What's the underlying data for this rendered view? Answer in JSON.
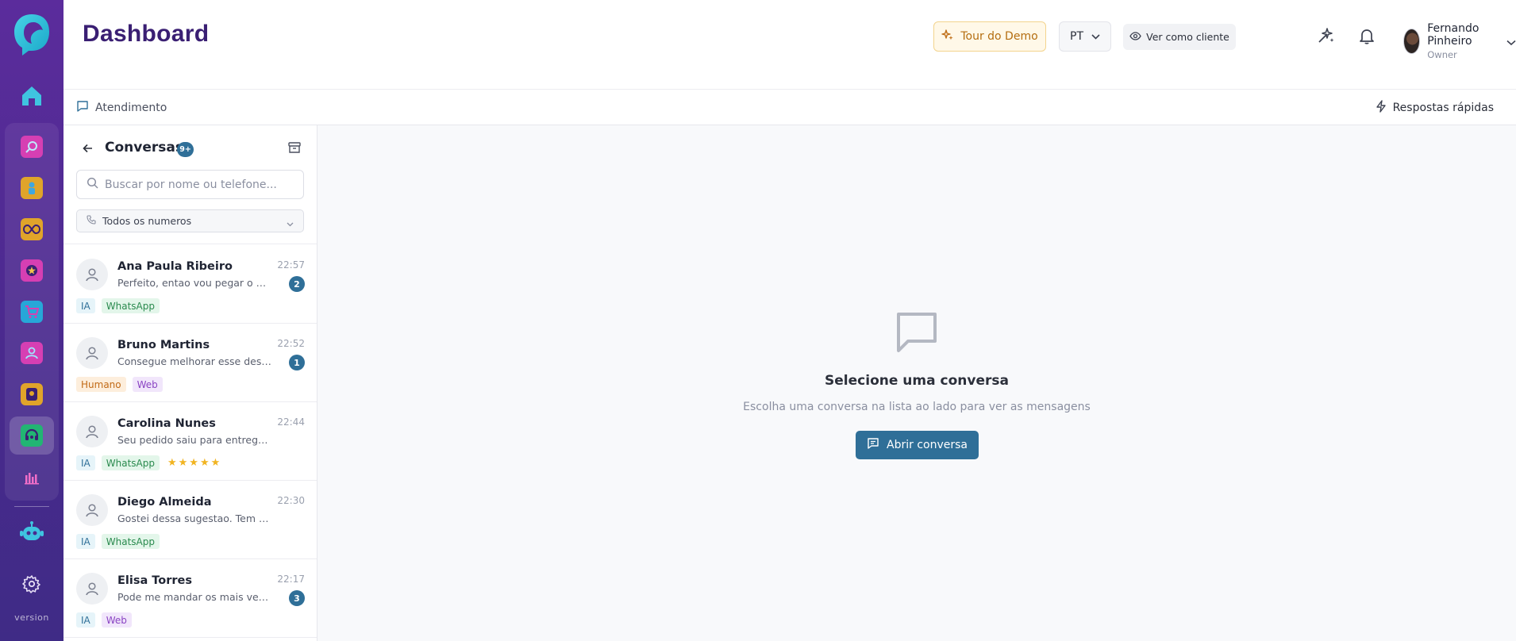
{
  "header": {
    "title": "Dashboard",
    "tour_label": "Tour do Demo",
    "language": "PT",
    "view_as_client_label": "Ver como cliente",
    "user": {
      "name": "Fernando Pinheiro",
      "role": "Owner"
    }
  },
  "sidebar": {
    "version_label": "version",
    "apps": [
      {
        "icon": "search-app-icon",
        "color": "#d63fb3"
      },
      {
        "icon": "person-app-icon",
        "color": "#e0a42a"
      },
      {
        "icon": "infinity-app-icon",
        "color": "#e0a42a"
      },
      {
        "icon": "star-badge-app-icon",
        "color": "#d63fb3"
      },
      {
        "icon": "cart-app-icon",
        "color": "#27a7d8"
      },
      {
        "icon": "user-app-icon",
        "color": "#d63fb3"
      },
      {
        "icon": "pin-app-icon",
        "color": "#e0a42a"
      },
      {
        "icon": "support-app-icon",
        "color": "#22b573",
        "active": true
      },
      {
        "icon": "chart-app-icon",
        "color": "#d63fb3"
      }
    ]
  },
  "subbar": {
    "breadcrumb": "Atendimento",
    "quick_replies": "Respostas rápidas"
  },
  "conversations": {
    "title": "Conversas",
    "count_badge": "9+",
    "search_placeholder": "Buscar por nome ou telefone...",
    "number_filter": "Todos os numeros",
    "items": [
      {
        "name": "Ana Paula Ribeiro",
        "time": "22:57",
        "preview": "Perfeito, entao vou pegar o M mesmo",
        "unread": "2",
        "tags": [
          "IA",
          "WhatsApp"
        ]
      },
      {
        "name": "Bruno Martins",
        "time": "22:52",
        "preview": "Consegue melhorar esse desconto?",
        "unread": "1",
        "tags": [
          "Humano",
          "Web"
        ]
      },
      {
        "name": "Carolina Nunes",
        "time": "22:44",
        "preview": "Seu pedido saiu para entrega hoje",
        "unread": "",
        "tags": [
          "IA",
          "WhatsApp"
        ],
        "rating": 5
      },
      {
        "name": "Diego Almeida",
        "time": "22:30",
        "preview": "Gostei dessa sugestao. Tem em azul?",
        "unread": "",
        "tags": [
          "IA",
          "WhatsApp"
        ]
      },
      {
        "name": "Elisa Torres",
        "time": "22:17",
        "preview": "Pode me mandar os mais vendidos?",
        "unread": "3",
        "tags": [
          "IA",
          "Web"
        ]
      }
    ]
  },
  "empty_state": {
    "title": "Selecione uma conversa",
    "subtitle": "Escolha uma conversa na lista ao lado para ver as mensagens",
    "button_label": "Abrir conversa"
  },
  "colors": {
    "brand_purple": "#4a2a8e",
    "accent_blue": "#2f6f98",
    "title_purple": "#3a1f73"
  }
}
